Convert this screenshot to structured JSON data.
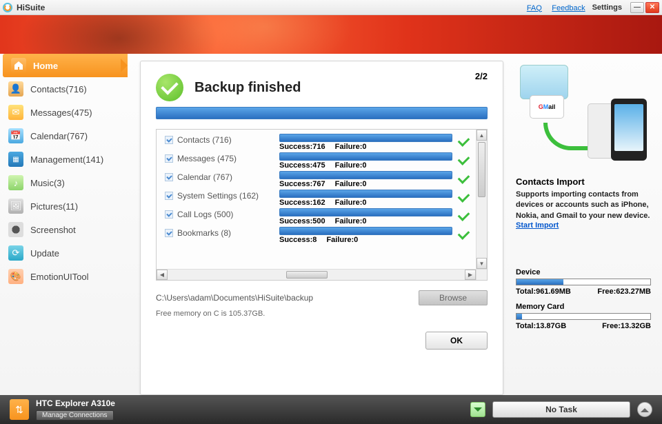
{
  "titlebar": {
    "title": "HiSuite",
    "faq": "FAQ",
    "feedback": "Feedback",
    "settings": "Settings"
  },
  "sidebar": {
    "items": [
      {
        "label": "Home",
        "active": true
      },
      {
        "label": "Contacts(716)"
      },
      {
        "label": "Messages(475)"
      },
      {
        "label": "Calendar(767)"
      },
      {
        "label": "Management(141)"
      },
      {
        "label": "Music(3)"
      },
      {
        "label": "Pictures(11)"
      },
      {
        "label": "Screenshot"
      },
      {
        "label": "Update"
      },
      {
        "label": "EmotionUITool"
      }
    ]
  },
  "panel": {
    "title": "Backup finished",
    "counter": "2/2",
    "items": [
      {
        "label": "Contacts (716)",
        "success": "Success:716",
        "failure": "Failure:0"
      },
      {
        "label": "Messages (475)",
        "success": "Success:475",
        "failure": "Failure:0"
      },
      {
        "label": "Calendar (767)",
        "success": "Success:767",
        "failure": "Failure:0"
      },
      {
        "label": "System Settings (162)",
        "success": "Success:162",
        "failure": "Failure:0"
      },
      {
        "label": "Call Logs (500)",
        "success": "Success:500",
        "failure": "Failure:0"
      },
      {
        "label": "Bookmarks (8)",
        "success": "Success:8",
        "failure": "Failure:0"
      }
    ],
    "path": "C:\\Users\\adam\\Documents\\HiSuite\\backup",
    "browse": "Browse",
    "free": "Free memory on C is 105.37GB.",
    "ok": "OK"
  },
  "right": {
    "title": "Contacts Import",
    "desc": "Supports importing contacts from devices or accounts such as iPhone, Nokia, and Gmail to your new device.",
    "link": "Start Import",
    "gmail_g": "G",
    "gmail_m": "M",
    "gmail_ail": "ail"
  },
  "storage": {
    "device": {
      "title": "Device",
      "total": "Total:961.69MB",
      "free": "Free:623.27MB",
      "pct": 35
    },
    "card": {
      "title": "Memory Card",
      "total": "Total:13.87GB",
      "free": "Free:13.32GB",
      "pct": 4
    }
  },
  "bottom": {
    "device": "HTC Explorer A310e",
    "manage": "Manage Connections",
    "task": "No Task"
  }
}
